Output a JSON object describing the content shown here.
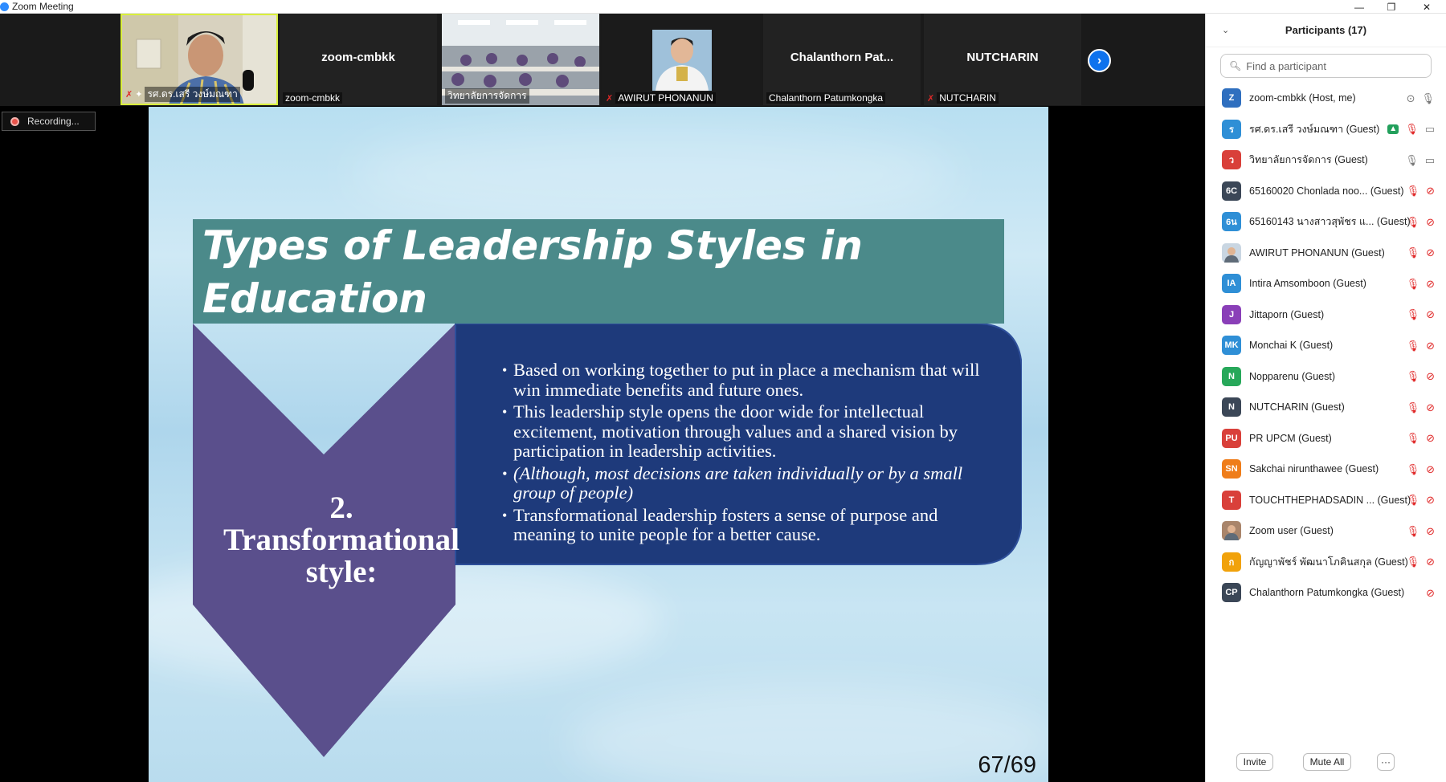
{
  "window": {
    "title": "Zoom Meeting"
  },
  "strip": {
    "tiles": [
      {
        "name": "รศ.ดร.เสรี วงษ์มณฑา",
        "big_name": "",
        "active": true,
        "muted": true,
        "pinned": true
      },
      {
        "name": "zoom-cmbkk",
        "big_name": "zoom-cmbkk",
        "active": false,
        "muted": false,
        "pinned": false
      },
      {
        "name": "วิทยาลัยการจัดการ",
        "big_name": "",
        "active": false,
        "muted": false,
        "pinned": false
      },
      {
        "name": "AWIRUT PHONANUN",
        "big_name": "",
        "active": false,
        "muted": true,
        "pinned": false
      },
      {
        "name": "Chalanthorn Patumkongka",
        "big_name": "Chalanthorn  Pat...",
        "active": false,
        "muted": false,
        "pinned": false
      },
      {
        "name": "NUTCHARIN",
        "big_name": "NUTCHARIN",
        "active": false,
        "muted": true,
        "pinned": false
      }
    ]
  },
  "recording": {
    "label": "Recording..."
  },
  "slide": {
    "title": "Types of Leadership Styles in Education",
    "title_line1": "Types of Leadership Styles in",
    "title_line2": "Education",
    "heading_line1": "2.",
    "heading_line2": "Transformational",
    "heading_line3": "style:",
    "bullets": [
      "Based on working together to put in  place a mechanism that will win  immediate benefits and future ones.",
      "This leadership style opens the door wide  for intellectual excitement, motivation  through values and a shared vision by  participation in leadership activities.",
      "(Although, most decisions are taken  individually or by a small group of people)",
      "Transformational leadership fosters a sense of purpose and meaning  to unite people for a better cause."
    ],
    "page": "67/69",
    "colors": {
      "title_bar": "#4b8a8a",
      "chevron": "#5a4f8c",
      "content_box": "#1e3a7b"
    }
  },
  "panel": {
    "title": "Participants (17)",
    "search_placeholder": "Find a participant",
    "participants": [
      {
        "initials": "Z",
        "name": "zoom-cmbkk",
        "suffix": " (Host, me)",
        "color": "#2f6fbf",
        "icons": [
          "record-gray",
          "mic-gray"
        ]
      },
      {
        "initials": "ร",
        "name": "รศ.ดร.เสรี วงษ์มณฑา",
        "suffix": " (Guest)",
        "color": "#2f8fd6",
        "icons": [
          "share-green",
          "mic-muted",
          "video-gray"
        ]
      },
      {
        "initials": "ว",
        "name": "วิทยาลัยการจัดการ",
        "suffix": " (Guest)",
        "color": "#d9403a",
        "icons": [
          "mic-gray",
          "video-gray"
        ]
      },
      {
        "initials": "6C",
        "name": "65160020 Chonlada noo...",
        "suffix": " (Guest)",
        "color": "#3b4757",
        "icons": [
          "mic-muted",
          "video-muted"
        ]
      },
      {
        "initials": "6น",
        "name": "65160143 นางสาวสุพัชร แ...",
        "suffix": " (Guest)",
        "color": "#2f8fd6",
        "icons": [
          "mic-muted",
          "video-muted"
        ]
      },
      {
        "initials": "",
        "name": "AWIRUT PHONANUN",
        "suffix": " (Guest)",
        "color": "#c9d6e2",
        "photo": true,
        "icons": [
          "mic-muted",
          "video-muted"
        ]
      },
      {
        "initials": "IA",
        "name": "Intira Amsomboon",
        "suffix": " (Guest)",
        "color": "#2f8fd6",
        "icons": [
          "mic-muted",
          "video-muted"
        ]
      },
      {
        "initials": "J",
        "name": "Jittaporn",
        "suffix": " (Guest)",
        "color": "#8a3fb8",
        "icons": [
          "mic-muted",
          "video-muted"
        ]
      },
      {
        "initials": "MK",
        "name": "Monchai K",
        "suffix": " (Guest)",
        "color": "#2f8fd6",
        "icons": [
          "mic-muted",
          "video-muted"
        ]
      },
      {
        "initials": "N",
        "name": "Nopparenu",
        "suffix": " (Guest)",
        "color": "#27a85a",
        "icons": [
          "mic-muted",
          "video-muted"
        ]
      },
      {
        "initials": "N",
        "name": "NUTCHARIN",
        "suffix": " (Guest)",
        "color": "#3b4757",
        "icons": [
          "mic-muted",
          "video-muted"
        ]
      },
      {
        "initials": "PU",
        "name": "PR UPCM",
        "suffix": " (Guest)",
        "color": "#d9403a",
        "icons": [
          "mic-muted",
          "video-muted"
        ]
      },
      {
        "initials": "SN",
        "name": "Sakchai nirunthawee",
        "suffix": " (Guest)",
        "color": "#ef7d1a",
        "icons": [
          "mic-muted",
          "video-muted"
        ]
      },
      {
        "initials": "T",
        "name": "TOUCHTHEPHADSADIN ...",
        "suffix": " (Guest)",
        "color": "#d9403a",
        "icons": [
          "mic-muted",
          "video-muted"
        ]
      },
      {
        "initials": "",
        "name": "Zoom user",
        "suffix": " (Guest)",
        "color": "#a9856b",
        "photo": true,
        "icons": [
          "mic-muted",
          "video-muted"
        ]
      },
      {
        "initials": "ก",
        "name": "กัญญาพัชร์ พัฒนาโภคินสกุล",
        "suffix": " (Guest)",
        "color": "#f1a20b",
        "icons": [
          "mic-muted",
          "video-muted"
        ]
      },
      {
        "initials": "CP",
        "name": "Chalanthorn Patumkongka",
        "suffix": " (Guest)",
        "color": "#3b4757",
        "icons": [
          "video-muted"
        ]
      }
    ],
    "footer": {
      "invite": "Invite",
      "mute_all": "Mute All",
      "more": "···"
    }
  }
}
